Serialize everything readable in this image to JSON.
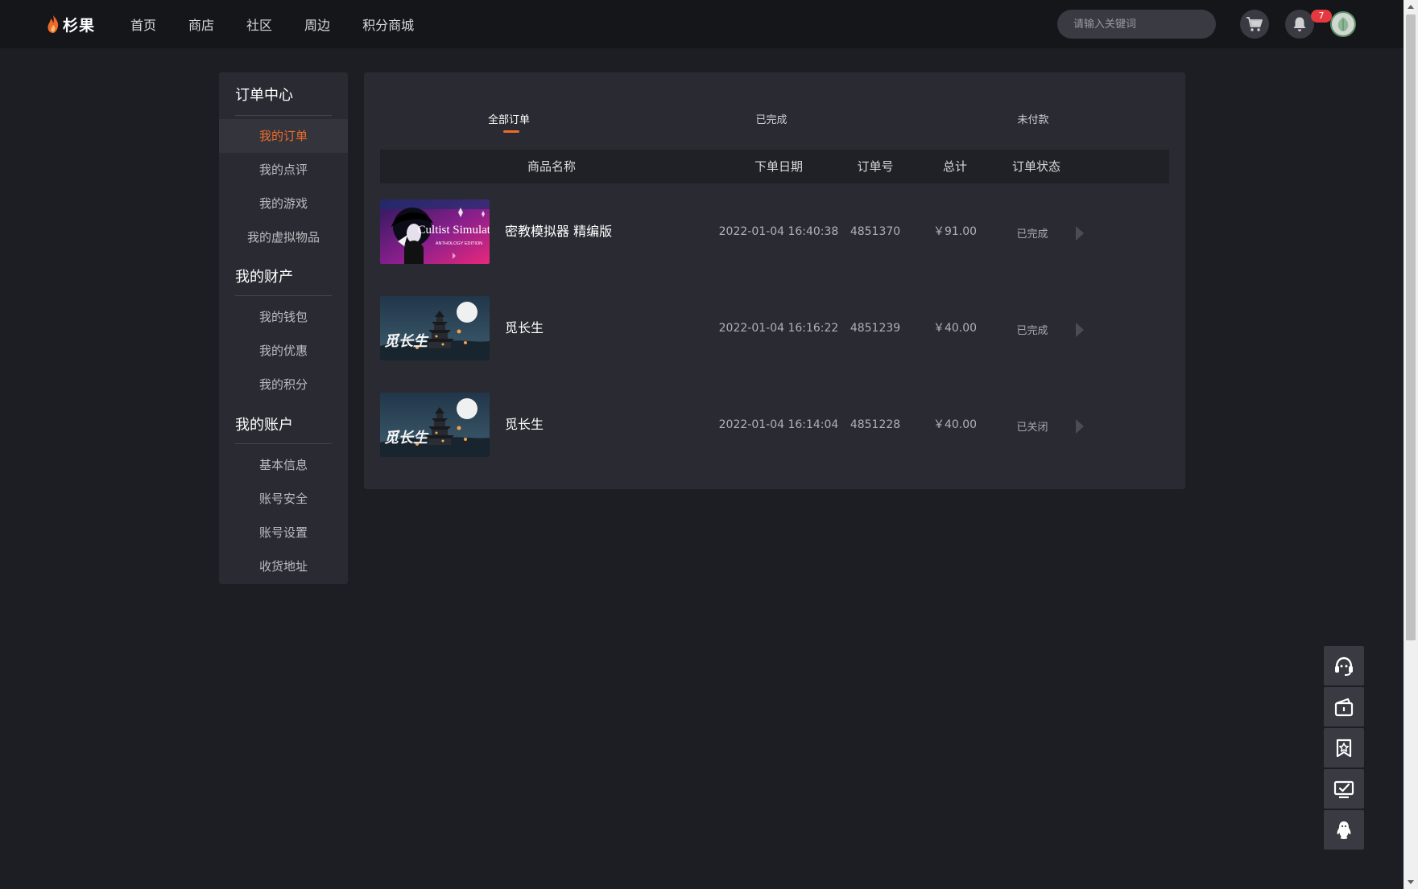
{
  "header": {
    "logo_text": "杉果",
    "nav": [
      "首页",
      "商店",
      "社区",
      "周边",
      "积分商城"
    ],
    "search_placeholder": "请输入关键词",
    "notification_count": "7"
  },
  "sidebar": {
    "sections": [
      {
        "title": "订单中心",
        "items": [
          "我的订单",
          "我的点评",
          "我的游戏",
          "我的虚拟物品"
        ]
      },
      {
        "title": "我的财产",
        "items": [
          "我的钱包",
          "我的优惠",
          "我的积分"
        ]
      },
      {
        "title": "我的账户",
        "items": [
          "基本信息",
          "账号安全",
          "账号设置",
          "收货地址"
        ]
      }
    ],
    "active_item": "我的订单"
  },
  "orders": {
    "tabs": [
      "全部订单",
      "已完成",
      "未付款"
    ],
    "active_tab": "全部订单",
    "columns": [
      "商品名称",
      "下单日期",
      "订单号",
      "总计",
      "订单状态"
    ],
    "rows": [
      {
        "name": "密教模拟器 精编版",
        "thumb_title": "Cultist Simulator",
        "thumb_subtitle": "ANTHOLOGY EDITION",
        "date": "2022-01-04 16:40:38",
        "order_no": "4851370",
        "total": "￥91.00",
        "status": "已完成"
      },
      {
        "name": "觅长生",
        "thumb_title": "觅长生",
        "date": "2022-01-04 16:16:22",
        "order_no": "4851239",
        "total": "￥40.00",
        "status": "已完成"
      },
      {
        "name": "觅长生",
        "thumb_title": "觅长生",
        "date": "2022-01-04 16:14:04",
        "order_no": "4851228",
        "total": "￥40.00",
        "status": "已关闭"
      }
    ]
  },
  "colors": {
    "accent": "#ef6a2a",
    "page_bg": "#1d1e24",
    "panel_bg": "#2a2b32",
    "topbar_bg": "#15161a",
    "badge": "#e6393f"
  },
  "float_toolbar": [
    "headset-icon",
    "wallet-icon",
    "bookmark-star-icon",
    "monitor-check-icon",
    "qq-penguin-icon"
  ]
}
